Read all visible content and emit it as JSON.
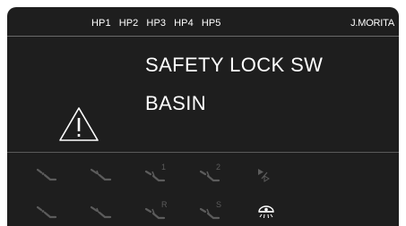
{
  "header": {
    "tabs": [
      {
        "label": "HP1"
      },
      {
        "label": "HP2"
      },
      {
        "label": "HP3"
      },
      {
        "label": "HP4"
      },
      {
        "label": "HP5"
      }
    ],
    "brand": "J.MORITA"
  },
  "message": {
    "line1": "SAFETY LOCK SW",
    "line2": "BASIN",
    "icon": "warning-triangle-icon"
  },
  "toolbar": {
    "row1": [
      {
        "icon": "handpiece-1-icon",
        "sub": ""
      },
      {
        "icon": "handpiece-2-icon",
        "sub": ""
      },
      {
        "icon": "handpiece-memory-1-icon",
        "sub": "1"
      },
      {
        "icon": "handpiece-memory-2-icon",
        "sub": "2"
      },
      {
        "icon": "play-step-icon",
        "sub": ""
      }
    ],
    "row2": [
      {
        "icon": "handpiece-3-icon",
        "sub": ""
      },
      {
        "icon": "handpiece-4-icon",
        "sub": ""
      },
      {
        "icon": "handpiece-reverse-icon",
        "sub": "R"
      },
      {
        "icon": "handpiece-spray-icon",
        "sub": "S"
      },
      {
        "icon": "operating-light-icon",
        "sub": ""
      }
    ]
  },
  "colors": {
    "screen_bg": "#1e1e1e",
    "text": "#ffffff",
    "dim_icon": "#5c5c5c",
    "active_icon": "#ffffff",
    "divider": "#6a6a6a"
  }
}
